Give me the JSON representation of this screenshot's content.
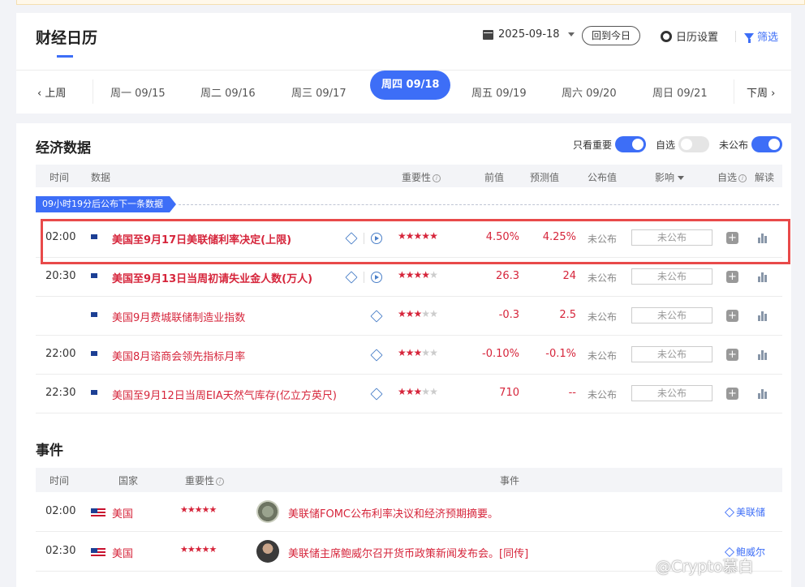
{
  "header": {
    "title": "财经日历",
    "date": "2025-09-18",
    "today_button": "回到今日",
    "settings_label": "日历设置",
    "filter_label": "筛选"
  },
  "week_nav": {
    "prev": "上周",
    "next": "下周",
    "days": [
      "周一 09/15",
      "周二 09/16",
      "周三 09/17",
      "周四 09/18",
      "周五 09/19",
      "周六 09/20",
      "周日 09/21"
    ],
    "active_index": 3
  },
  "econ": {
    "title": "经济数据",
    "toggles": [
      {
        "label": "只看重要",
        "on": true
      },
      {
        "label": "自选",
        "on": false
      },
      {
        "label": "未公布",
        "on": true
      }
    ],
    "columns": {
      "time": "时间",
      "data": "数据",
      "importance": "重要性",
      "prev": "前值",
      "forecast": "预测值",
      "actual": "公布值",
      "impact": "影响",
      "watch": "自选",
      "analysis": "解读"
    },
    "banner": "09小时19分后公布下一条数据",
    "rows": [
      {
        "time": "02:00",
        "name": "美国至9月17日美联储利率决定(上限)",
        "bold": true,
        "stars": 5,
        "has_video": true,
        "prev": "4.50%",
        "forecast": "4.25%",
        "actual": "未公布",
        "impact": "未公布"
      },
      {
        "time": "20:30",
        "name": "美国至9月13日当周初请失业金人数(万人)",
        "bold": true,
        "stars": 4,
        "has_video": true,
        "prev": "26.3",
        "forecast": "24",
        "actual": "未公布",
        "impact": "未公布"
      },
      {
        "time": "",
        "name": "美国9月费城联储制造业指数",
        "bold": false,
        "stars": 3,
        "has_video": false,
        "prev": "-0.3",
        "forecast": "2.5",
        "actual": "未公布",
        "impact": "未公布"
      },
      {
        "time": "22:00",
        "name": "美国8月谘商会领先指标月率",
        "bold": false,
        "stars": 3,
        "has_video": false,
        "prev": "-0.10%",
        "forecast": "-0.1%",
        "actual": "未公布",
        "impact": "未公布"
      },
      {
        "time": "22:30",
        "name": "美国至9月12日当周EIA天然气库存(亿立方英尺)",
        "bold": false,
        "stars": 3,
        "has_video": false,
        "prev": "710",
        "forecast": "--",
        "actual": "未公布",
        "impact": "未公布"
      }
    ]
  },
  "events": {
    "title": "事件",
    "columns": {
      "time": "时间",
      "country": "国家",
      "importance": "重要性",
      "event": "事件"
    },
    "rows": [
      {
        "time": "02:00",
        "country": "美国",
        "stars": "★★★★★",
        "avatar": "seal",
        "text": "美联储FOMC公布利率决议和经济预期摘要。",
        "tag": "美联储"
      },
      {
        "time": "02:30",
        "country": "美国",
        "stars": "★★★★★",
        "avatar": "person",
        "text": "美联储主席鲍威尔召开货币政策新闻发布会。[同传]",
        "tag": "鲍威尔"
      }
    ]
  },
  "watermark": "@Crypto慕白",
  "colors": {
    "accent": "#3d6ef7",
    "highlight": "#e84a4a",
    "data_red": "#d6253b"
  }
}
